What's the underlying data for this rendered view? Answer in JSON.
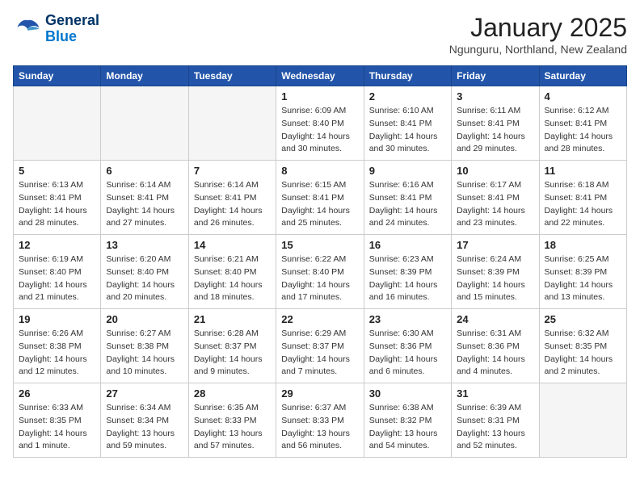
{
  "header": {
    "logo_line1": "General",
    "logo_line2": "Blue",
    "month_year": "January 2025",
    "location": "Ngunguru, Northland, New Zealand"
  },
  "weekdays": [
    "Sunday",
    "Monday",
    "Tuesday",
    "Wednesday",
    "Thursday",
    "Friday",
    "Saturday"
  ],
  "weeks": [
    [
      {
        "day": "",
        "info": ""
      },
      {
        "day": "",
        "info": ""
      },
      {
        "day": "",
        "info": ""
      },
      {
        "day": "1",
        "info": "Sunrise: 6:09 AM\nSunset: 8:40 PM\nDaylight: 14 hours\nand 30 minutes."
      },
      {
        "day": "2",
        "info": "Sunrise: 6:10 AM\nSunset: 8:41 PM\nDaylight: 14 hours\nand 30 minutes."
      },
      {
        "day": "3",
        "info": "Sunrise: 6:11 AM\nSunset: 8:41 PM\nDaylight: 14 hours\nand 29 minutes."
      },
      {
        "day": "4",
        "info": "Sunrise: 6:12 AM\nSunset: 8:41 PM\nDaylight: 14 hours\nand 28 minutes."
      }
    ],
    [
      {
        "day": "5",
        "info": "Sunrise: 6:13 AM\nSunset: 8:41 PM\nDaylight: 14 hours\nand 28 minutes."
      },
      {
        "day": "6",
        "info": "Sunrise: 6:14 AM\nSunset: 8:41 PM\nDaylight: 14 hours\nand 27 minutes."
      },
      {
        "day": "7",
        "info": "Sunrise: 6:14 AM\nSunset: 8:41 PM\nDaylight: 14 hours\nand 26 minutes."
      },
      {
        "day": "8",
        "info": "Sunrise: 6:15 AM\nSunset: 8:41 PM\nDaylight: 14 hours\nand 25 minutes."
      },
      {
        "day": "9",
        "info": "Sunrise: 6:16 AM\nSunset: 8:41 PM\nDaylight: 14 hours\nand 24 minutes."
      },
      {
        "day": "10",
        "info": "Sunrise: 6:17 AM\nSunset: 8:41 PM\nDaylight: 14 hours\nand 23 minutes."
      },
      {
        "day": "11",
        "info": "Sunrise: 6:18 AM\nSunset: 8:41 PM\nDaylight: 14 hours\nand 22 minutes."
      }
    ],
    [
      {
        "day": "12",
        "info": "Sunrise: 6:19 AM\nSunset: 8:40 PM\nDaylight: 14 hours\nand 21 minutes."
      },
      {
        "day": "13",
        "info": "Sunrise: 6:20 AM\nSunset: 8:40 PM\nDaylight: 14 hours\nand 20 minutes."
      },
      {
        "day": "14",
        "info": "Sunrise: 6:21 AM\nSunset: 8:40 PM\nDaylight: 14 hours\nand 18 minutes."
      },
      {
        "day": "15",
        "info": "Sunrise: 6:22 AM\nSunset: 8:40 PM\nDaylight: 14 hours\nand 17 minutes."
      },
      {
        "day": "16",
        "info": "Sunrise: 6:23 AM\nSunset: 8:39 PM\nDaylight: 14 hours\nand 16 minutes."
      },
      {
        "day": "17",
        "info": "Sunrise: 6:24 AM\nSunset: 8:39 PM\nDaylight: 14 hours\nand 15 minutes."
      },
      {
        "day": "18",
        "info": "Sunrise: 6:25 AM\nSunset: 8:39 PM\nDaylight: 14 hours\nand 13 minutes."
      }
    ],
    [
      {
        "day": "19",
        "info": "Sunrise: 6:26 AM\nSunset: 8:38 PM\nDaylight: 14 hours\nand 12 minutes."
      },
      {
        "day": "20",
        "info": "Sunrise: 6:27 AM\nSunset: 8:38 PM\nDaylight: 14 hours\nand 10 minutes."
      },
      {
        "day": "21",
        "info": "Sunrise: 6:28 AM\nSunset: 8:37 PM\nDaylight: 14 hours\nand 9 minutes."
      },
      {
        "day": "22",
        "info": "Sunrise: 6:29 AM\nSunset: 8:37 PM\nDaylight: 14 hours\nand 7 minutes."
      },
      {
        "day": "23",
        "info": "Sunrise: 6:30 AM\nSunset: 8:36 PM\nDaylight: 14 hours\nand 6 minutes."
      },
      {
        "day": "24",
        "info": "Sunrise: 6:31 AM\nSunset: 8:36 PM\nDaylight: 14 hours\nand 4 minutes."
      },
      {
        "day": "25",
        "info": "Sunrise: 6:32 AM\nSunset: 8:35 PM\nDaylight: 14 hours\nand 2 minutes."
      }
    ],
    [
      {
        "day": "26",
        "info": "Sunrise: 6:33 AM\nSunset: 8:35 PM\nDaylight: 14 hours\nand 1 minute."
      },
      {
        "day": "27",
        "info": "Sunrise: 6:34 AM\nSunset: 8:34 PM\nDaylight: 13 hours\nand 59 minutes."
      },
      {
        "day": "28",
        "info": "Sunrise: 6:35 AM\nSunset: 8:33 PM\nDaylight: 13 hours\nand 57 minutes."
      },
      {
        "day": "29",
        "info": "Sunrise: 6:37 AM\nSunset: 8:33 PM\nDaylight: 13 hours\nand 56 minutes."
      },
      {
        "day": "30",
        "info": "Sunrise: 6:38 AM\nSunset: 8:32 PM\nDaylight: 13 hours\nand 54 minutes."
      },
      {
        "day": "31",
        "info": "Sunrise: 6:39 AM\nSunset: 8:31 PM\nDaylight: 13 hours\nand 52 minutes."
      },
      {
        "day": "",
        "info": ""
      }
    ]
  ]
}
